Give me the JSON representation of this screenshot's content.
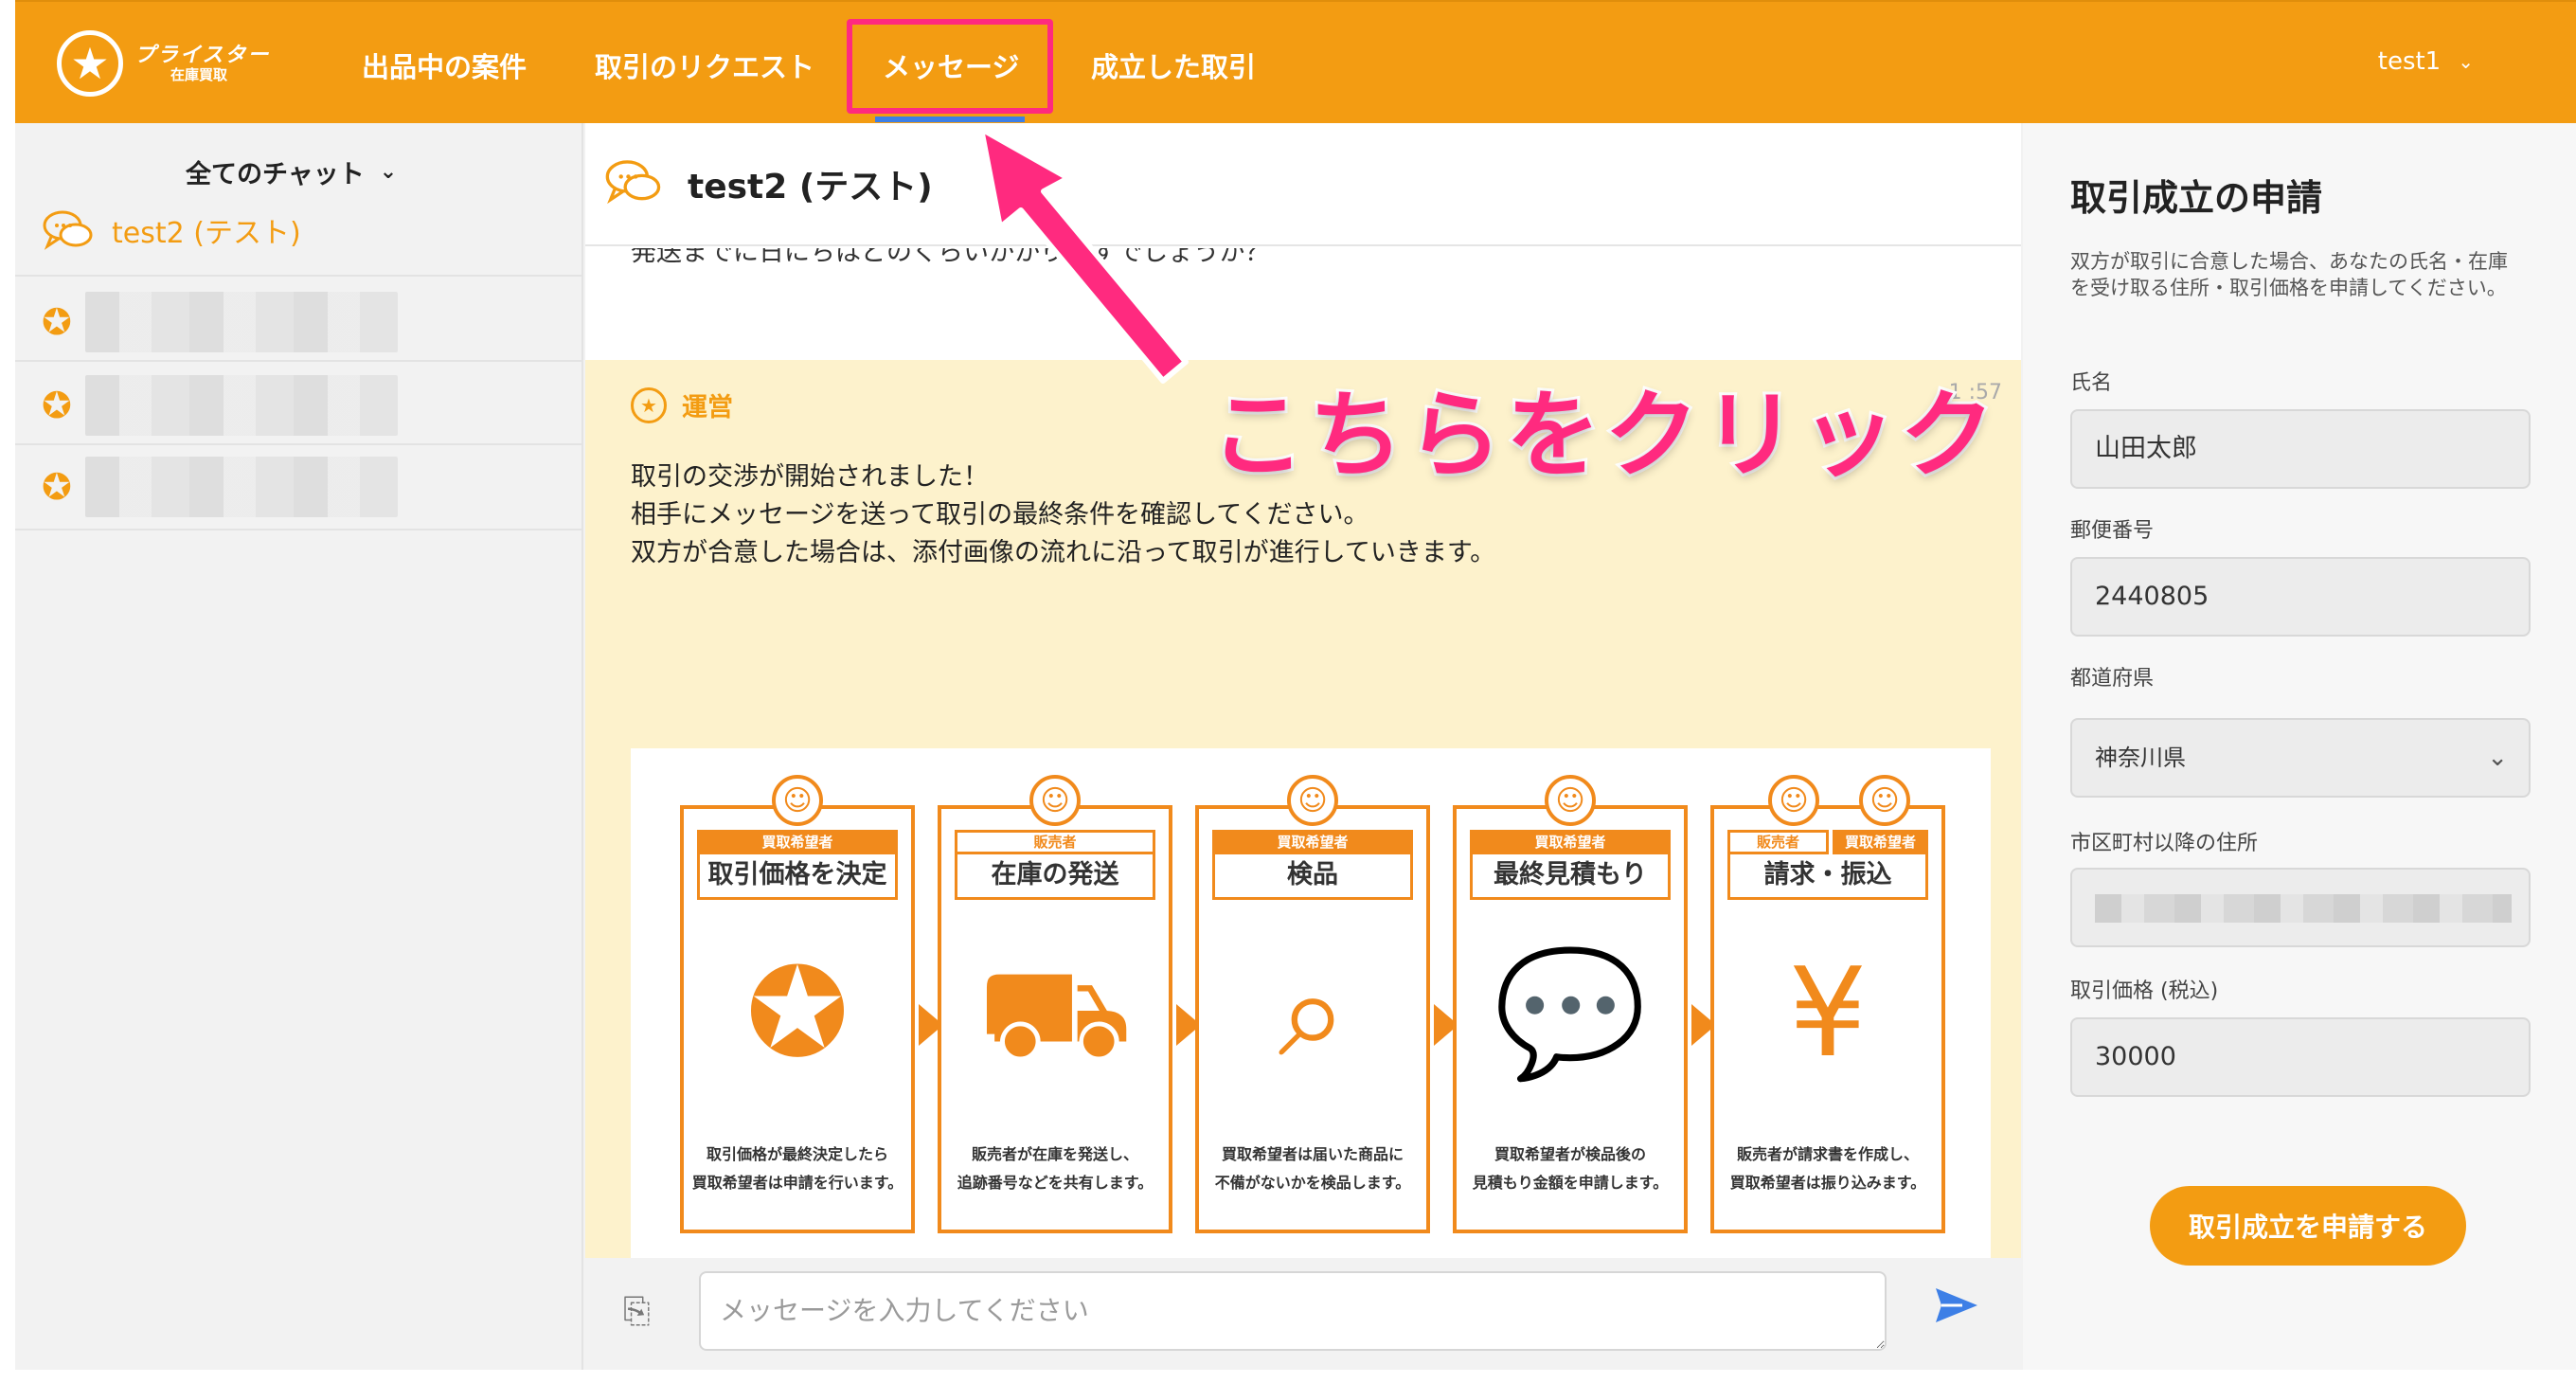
{
  "header": {
    "logo_title": "プライスター",
    "logo_subtitle": "在庫買取",
    "nav": [
      "出品中の案件",
      "取引のリクエスト",
      "メッセージ",
      "成立した取引"
    ],
    "user": "test1",
    "accent_color": "#f39c12"
  },
  "sidebar": {
    "filter_label": "全てのチャット",
    "active_chat": "test2 (テスト)"
  },
  "chat": {
    "title": "test2 (テスト)",
    "previous_message_fragment": "発送までに日にちはどのくらいかかりますでしょうか？",
    "system_sender": "運営",
    "system_time": "1 :57",
    "system_lines": [
      "取引の交渉が開始されました！",
      "相手にメッセージを送って取引の最終条件を確認してください。",
      "双方が合意した場合は、添付画像の流れに沿って取引が進行していきます。"
    ],
    "steps": [
      {
        "role": "買取希望者",
        "title": "取引価格を決定",
        "desc1": "取引価格が最終決定したら",
        "desc2": "買取希望者は申請を行います。"
      },
      {
        "role": "販売者",
        "title": "在庫の発送",
        "desc1": "販売者が在庫を発送し、",
        "desc2": "追跡番号などを共有します。"
      },
      {
        "role": "買取希望者",
        "title": "検品",
        "desc1": "買取希望者は届いた商品に",
        "desc2": "不備がないかを検品します。"
      },
      {
        "role": "買取希望者",
        "title": "最終見積もり",
        "desc1": "買取希望者が検品後の",
        "desc2": "見積もり金額を申請します。"
      },
      {
        "role_a": "販売者",
        "role_b": "買取希望者",
        "title": "請求・振込",
        "desc1": "販売者が請求書を作成し、",
        "desc2": "買取希望者は振り込みます。"
      }
    ],
    "input_placeholder": "メッセージを入力してください"
  },
  "right_panel": {
    "title": "取引成立の申請",
    "description": "双方が取引に合意した場合、あなたの氏名・在庫を受け取る住所・取引価格を申請してください。",
    "name_label": "氏名",
    "name_value": "山田太郎",
    "zip_label": "郵便番号",
    "zip_value": "2440805",
    "pref_label": "都道府県",
    "pref_value": "神奈川県",
    "address_label": "市区町村以降の住所",
    "price_label": "取引価格 (税込)",
    "price_value": "30000",
    "submit_label": "取引成立を申請する"
  },
  "annotation": {
    "callout_text": "こちらをクリック",
    "color": "#ff2a7f"
  }
}
